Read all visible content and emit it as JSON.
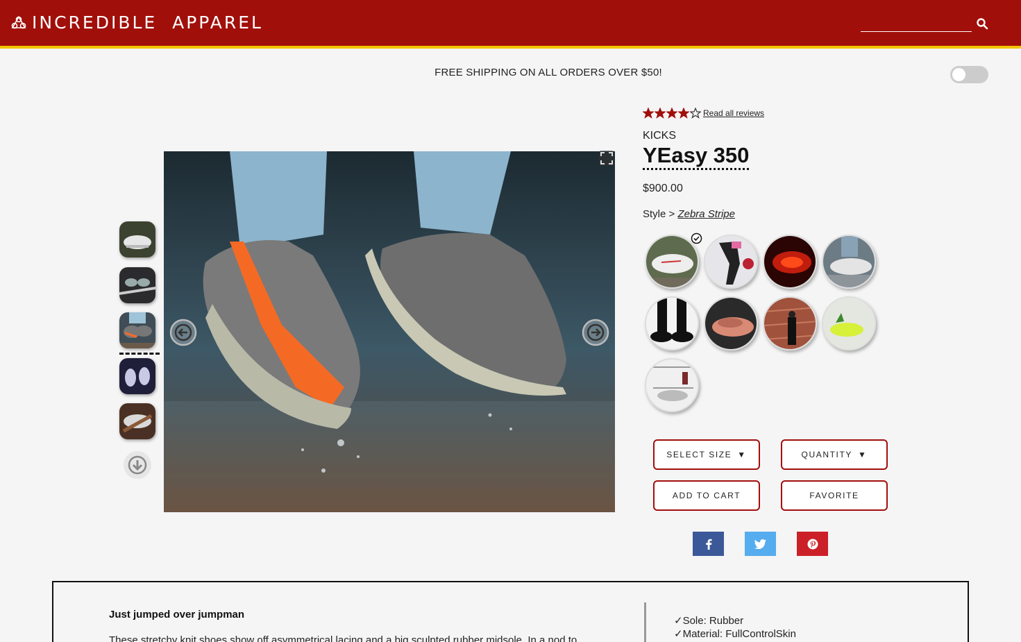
{
  "header": {
    "brand": "INCREDIBLE  APPAREL",
    "search_value": "",
    "colors": {
      "bar": "#a10f0b",
      "accent_stripe": "#f2c400"
    }
  },
  "banner": {
    "text": "FREE SHIPPING ON ALL ORDERS OVER $50!"
  },
  "theme_toggle": {
    "on": false
  },
  "gallery": {
    "thumbnails": [
      "thumb-1",
      "thumb-2",
      "thumb-3",
      "thumb-4",
      "thumb-5"
    ],
    "selected_index": 3
  },
  "product": {
    "rating": 4,
    "rating_max": 5,
    "reviews_link": "Read all reviews",
    "category": "KICKS",
    "name": "YEasy 350",
    "price": "$900.00",
    "style_label": "Style >",
    "style_name": "Zebra Stripe",
    "styles_count": 9,
    "selected_style_index": 0
  },
  "actions": {
    "select_size": "SELECT SIZE",
    "quantity": "QUANTITY",
    "add_to_cart": "ADD TO CART",
    "favorite": "FAVORITE"
  },
  "social": {
    "facebook_color": "#3b5998",
    "twitter_color": "#55acee",
    "pinterest_color": "#cb2027"
  },
  "description": {
    "slogan": "Just jumped over jumpman",
    "body": "These stretchy knit shoes show off asymmetrical lacing and a big sculpted rubber midsole. In a nod to",
    "features": [
      "Sole: Rubber",
      "Material: FullControlSkin"
    ]
  }
}
